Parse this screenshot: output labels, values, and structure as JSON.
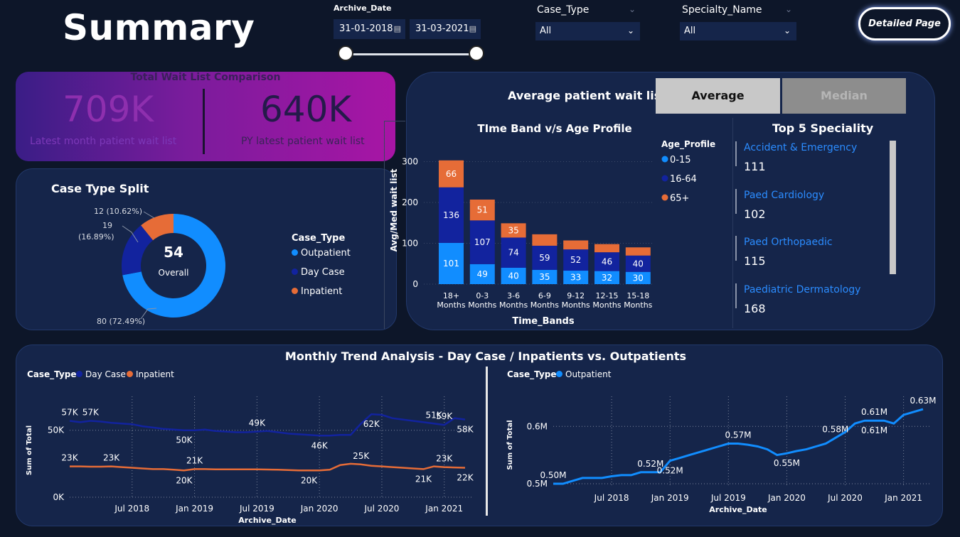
{
  "header": {
    "title": "Summary",
    "archive_label": "Archive_Date",
    "date_from": "31-01-2018",
    "date_to": "31-03-2021",
    "case_type_label": "Case_Type",
    "case_type_value": "All",
    "specialty_label": "Specialty_Name",
    "specialty_value": "All",
    "detail_button": "Detailed Page",
    "calendar_icon": "calendar-icon",
    "chevron_icon": "chevron-down-icon"
  },
  "kpi": {
    "title": "Total Wait List Comparison",
    "latest_value": "709K",
    "latest_label": "Latest month patient wait list",
    "py_value": "640K",
    "py_label": "PY latest patient wait list"
  },
  "case_split": {
    "title": "Case Type Split",
    "center_value": "54",
    "center_label": "Overall",
    "legend_title": "Case_Type",
    "colors": {
      "Outpatient": "#118dff",
      "Day Case": "#12239e",
      "Inpatient": "#e66c37"
    }
  },
  "avg_panel": {
    "title": "Average patient wait list",
    "btn_average": "Average",
    "btn_median": "Median"
  },
  "specialities": {
    "title": "Top 5 Speciality",
    "items": [
      {
        "name": "Accident & Emergency",
        "value": "111"
      },
      {
        "name": "Paed Cardiology",
        "value": "102"
      },
      {
        "name": "Paed Orthopaedic",
        "value": "115"
      },
      {
        "name": "Paediatric Dermatology",
        "value": "168"
      }
    ]
  },
  "trend": {
    "title": "Monthly Trend Analysis - Day Case / Inpatients vs. Outpatients",
    "left_legend_title": "Case_Type",
    "left_legend_items": [
      "Day Case",
      "Inpatient"
    ],
    "right_legend_title": "Case_Type",
    "right_legend_items": [
      "Outpatient"
    ]
  },
  "chart_data": [
    {
      "type": "pie",
      "title": "Case Type Split",
      "donut": true,
      "categories": [
        "Outpatient",
        "Day Case",
        "Inpatient"
      ],
      "values": [
        80,
        19,
        12
      ],
      "labels": [
        "80 (72.49%)",
        "19 (16.89%)",
        "12 (10.62%)"
      ],
      "center": "54",
      "legend_title": "Case_Type",
      "legend_position": "right"
    },
    {
      "type": "bar",
      "stacked": true,
      "title": "TIme Band v/s Age Profile",
      "xlabel": "Time_Bands",
      "ylabel": "Avg/Med wait list",
      "ylim": [
        0,
        320
      ],
      "yticks": [
        0,
        100,
        200,
        300
      ],
      "categories": [
        "18+ Months",
        "0-3 Months",
        "3-6 Months",
        "6-9 Months",
        "9-12 Months",
        "12-15 Months",
        "15-18 Months"
      ],
      "legend_title": "Age_Profile",
      "legend_position": "right",
      "series": [
        {
          "name": "0-15",
          "color": "#118dff",
          "values": [
            101,
            49,
            40,
            35,
            33,
            32,
            30
          ]
        },
        {
          "name": "16-64",
          "color": "#12239e",
          "values": [
            136,
            107,
            74,
            59,
            52,
            46,
            40
          ]
        },
        {
          "name": "65+",
          "color": "#e66c37",
          "values": [
            66,
            51,
            35,
            28,
            22,
            20,
            20
          ],
          "labeled": [
            true,
            true,
            true,
            false,
            false,
            false,
            false
          ]
        }
      ]
    },
    {
      "type": "line",
      "title": "Monthly Trend Analysis - Day Case / Inpatients vs. Outpatients",
      "xlabel": "Archive_Date",
      "ylabel": "Sum of Total",
      "ylim": [
        0,
        70000
      ],
      "yticks": [
        {
          "v": 0,
          "label": "0K"
        },
        {
          "v": 50000,
          "label": "50K"
        }
      ],
      "xticks": [
        "Jul 2018",
        "Jan 2019",
        "Jul 2019",
        "Jan 2020",
        "Jul 2020",
        "Jan 2021"
      ],
      "xrange": [
        0,
        38
      ],
      "xtick_pos": [
        6,
        12,
        18,
        24,
        30,
        36
      ],
      "series": [
        {
          "name": "Day Case",
          "color": "#12239e",
          "values": [
            57000,
            56000,
            57000,
            56500,
            55500,
            55000,
            54500,
            53000,
            52000,
            51000,
            50500,
            50000,
            50000,
            50500,
            49500,
            49000,
            48500,
            48500,
            49000,
            49500,
            48500,
            47500,
            47000,
            46500,
            46000,
            46000,
            46500,
            46500,
            55000,
            62000,
            61500,
            59000,
            58000,
            57000,
            56000,
            55000,
            54000,
            59000,
            58000
          ],
          "labels": [
            [
              0,
              "57K"
            ],
            [
              2,
              "57K"
            ],
            [
              11,
              "50K"
            ],
            [
              18,
              "49K"
            ],
            [
              24,
              "46K"
            ],
            [
              29,
              "62K"
            ],
            [
              35,
              "51K"
            ],
            [
              36,
              "59K"
            ],
            [
              38,
              "58K"
            ]
          ]
        },
        {
          "name": "Inpatient",
          "color": "#e66c37",
          "values": [
            23000,
            23000,
            22800,
            22800,
            23000,
            22500,
            22000,
            21500,
            21000,
            21000,
            20500,
            20000,
            21000,
            21000,
            20800,
            20800,
            20800,
            20800,
            20800,
            20700,
            20500,
            20300,
            20000,
            20000,
            20000,
            20500,
            24000,
            25000,
            24500,
            23500,
            23000,
            22500,
            22000,
            21500,
            21000,
            23000,
            22500,
            22200,
            22000
          ],
          "labels": [
            [
              0,
              "23K"
            ],
            [
              4,
              "23K"
            ],
            [
              11,
              "20K"
            ],
            [
              12,
              "21K"
            ],
            [
              23,
              "20K"
            ],
            [
              28,
              "25K"
            ],
            [
              34,
              "21K"
            ],
            [
              36,
              "23K"
            ],
            [
              38,
              "22K"
            ]
          ]
        }
      ]
    },
    {
      "type": "line",
      "xlabel": "Archive_Date",
      "ylabel": "Sum of Total",
      "ylim": [
        0.495,
        0.64
      ],
      "yticks": [
        {
          "v": 0.5,
          "label": "0.5M"
        },
        {
          "v": 0.6,
          "label": "0.6M"
        }
      ],
      "xticks": [
        "Jul 2018",
        "Jan 2019",
        "Jul 2019",
        "Jan 2020",
        "Jul 2020",
        "Jan 2021"
      ],
      "xrange": [
        0,
        38
      ],
      "xtick_pos": [
        6,
        12,
        18,
        24,
        30,
        36
      ],
      "series": [
        {
          "name": "Outpatient",
          "color": "#118dff",
          "values": [
            0.5,
            0.5,
            0.505,
            0.51,
            0.51,
            0.51,
            0.513,
            0.515,
            0.515,
            0.52,
            0.52,
            0.52,
            0.54,
            0.545,
            0.55,
            0.555,
            0.56,
            0.565,
            0.57,
            0.57,
            0.568,
            0.565,
            0.56,
            0.55,
            0.553,
            0.557,
            0.56,
            0.565,
            0.57,
            0.58,
            0.59,
            0.605,
            0.61,
            0.61,
            0.61,
            0.605,
            0.62,
            0.625,
            0.63
          ],
          "labels": [
            [
              0,
              "0.50M"
            ],
            [
              10,
              "0.52M"
            ],
            [
              12,
              "0.52M"
            ],
            [
              19,
              "0.57M"
            ],
            [
              24,
              "0.55M"
            ],
            [
              29,
              "0.58M"
            ],
            [
              33,
              "0.61M"
            ],
            [
              33,
              "0.61M"
            ],
            [
              38,
              "0.63M"
            ]
          ]
        }
      ]
    }
  ]
}
